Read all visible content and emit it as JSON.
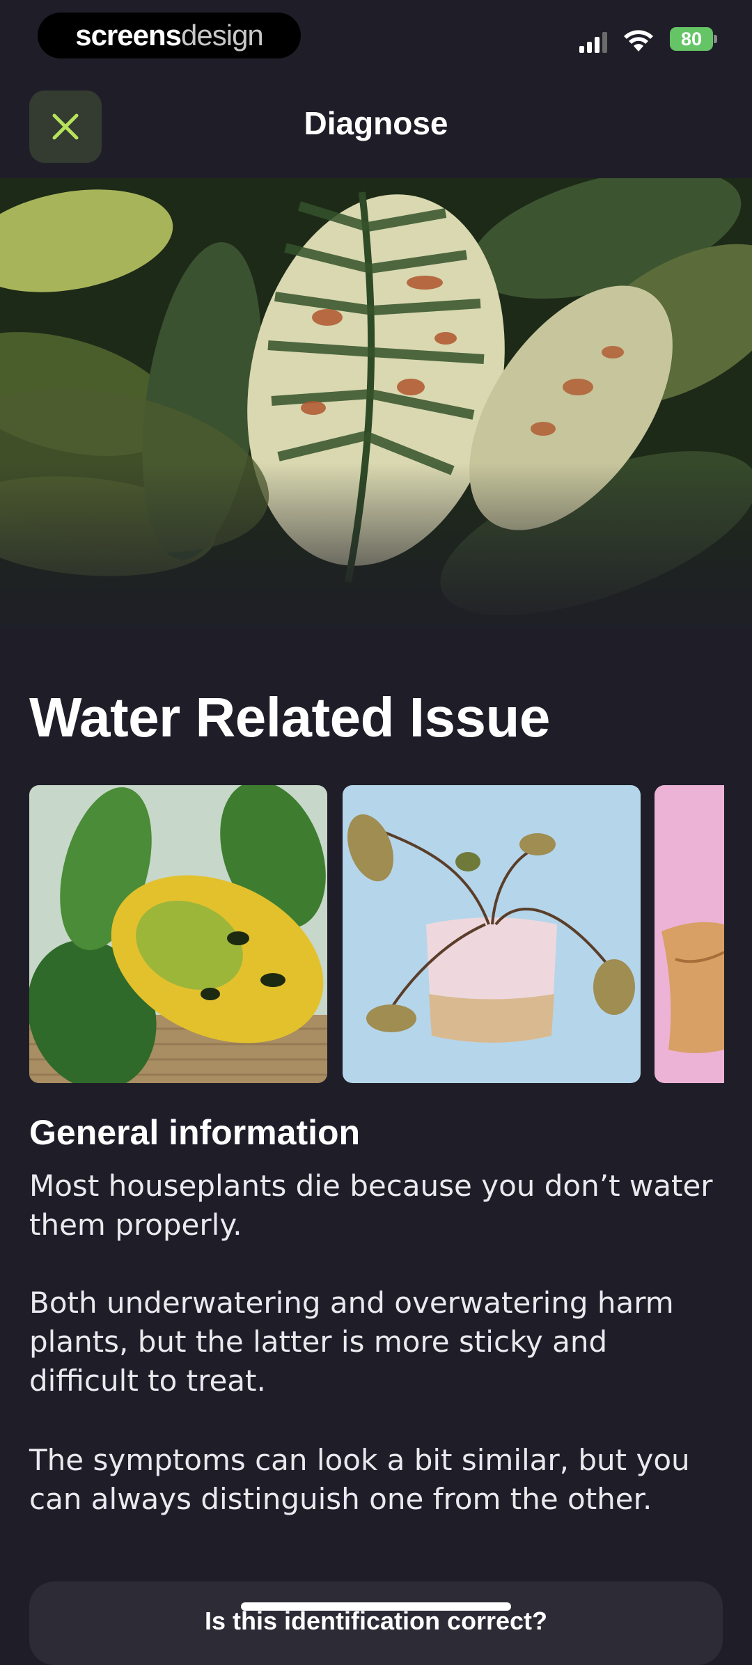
{
  "status_bar": {
    "brand_part1": "screens",
    "brand_part2": "design",
    "battery": "80"
  },
  "header": {
    "title": "Diagnose",
    "close_icon": "close-icon"
  },
  "issue": {
    "title": "Water Related Issue"
  },
  "gallery": {
    "images": [
      "yellowing-monstera-leaf",
      "drooping-plant-pink-pot",
      "dried-leaf-pink-background"
    ]
  },
  "general_info": {
    "heading": "General information",
    "paragraphs": [
      "Most houseplants die because you don’t water them properly.",
      "Both underwatering and overwatering harm plants, but the latter is more sticky and difficult to treat.",
      "The symptoms can look a bit similar, but you can always distinguish one from the other."
    ]
  },
  "feedback": {
    "question": "Is this identification correct?"
  },
  "colors": {
    "background": "#1f1e28",
    "accent": "#b6e35b",
    "battery": "#65c466"
  }
}
